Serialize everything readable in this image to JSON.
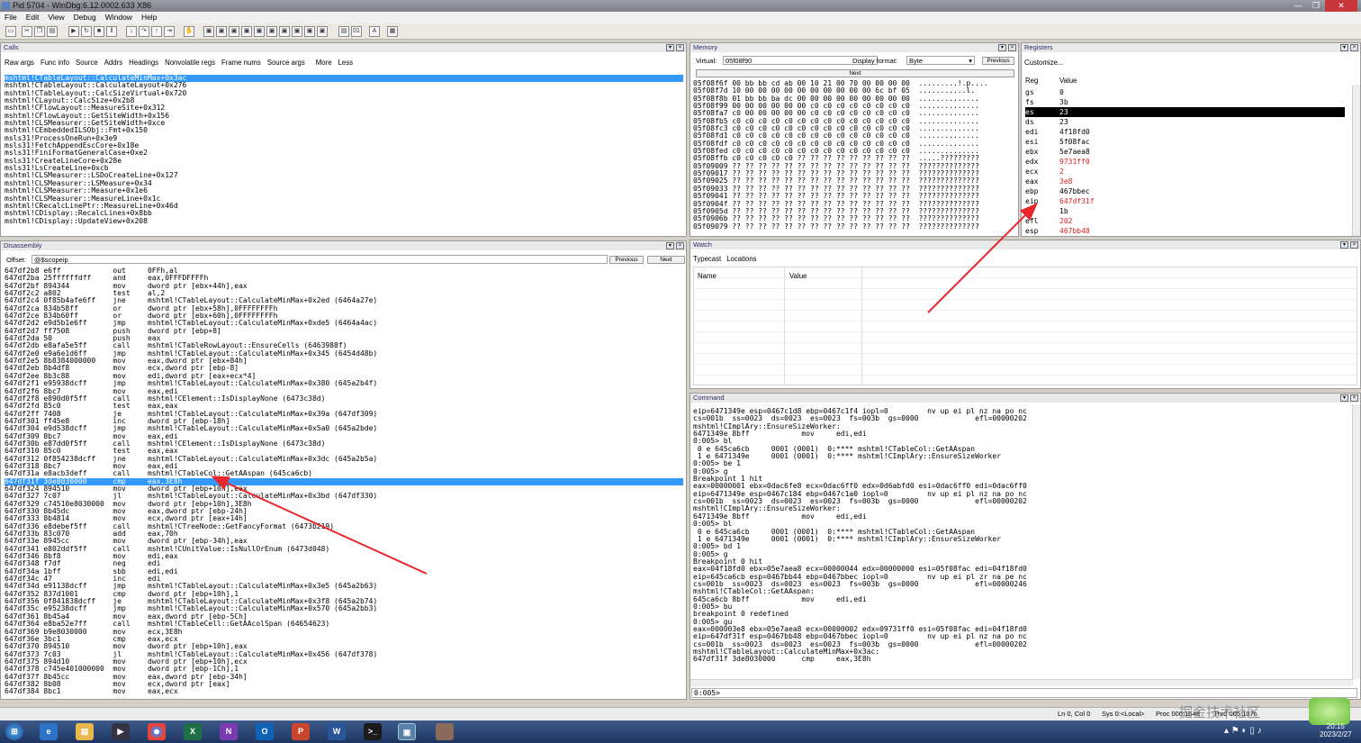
{
  "window": {
    "title": "Pid 5704 - WinDbg:6.12.0002.633 X86",
    "buttons": [
      "—",
      "❐",
      "✕"
    ]
  },
  "menu": [
    "File",
    "Edit",
    "View",
    "Debug",
    "Window",
    "Help"
  ],
  "calls": {
    "title": "Calls",
    "buttons": [
      "Raw args",
      "Func info",
      "Source",
      "Addrs",
      "Headings",
      "Nonvolatile regs",
      "Frame nums",
      "Source args",
      "More",
      "Less"
    ],
    "lines": [
      "mshtml!CTableLayout::CalculateMinMax+0x3ac",
      "mshtml!CTableLayout::CalculateLayout+0x276",
      "mshtml!CTableLayout::CalcSizeVirtual+0x720",
      "mshtml!CLayout::CalcSize+0x2b8",
      "mshtml!CFlowLayout::MeasureSite+0x312",
      "mshtml!CFlowLayout::GetSiteWidth+0x156",
      "mshtml!CLSMeasurer::GetSiteWidth+0xce",
      "mshtml!CEmbeddedILSObj::Fmt+0x150",
      "msls31!ProcessOneRun+0x3e9",
      "msls31!FetchAppendEscCore+0x18e",
      "msls31!FiniFormatGeneralCase+0xe2",
      "msls31!CreateLineCore+0x28e",
      "msls31!LsCreateLine+0xcb",
      "mshtml!CLSMeasurer::LSDoCreateLine+0x127",
      "mshtml!CLSMeasurer::LSMeasure+0x34",
      "mshtml!CLSMeasurer::Measure+0x1e6",
      "mshtml!CLSMeasurer::MeasureLine+0x1c",
      "mshtml!CRecalcLinePtr::MeasureLine+0x46d",
      "mshtml!CDisplay::RecalcLines+0x8bb",
      "mshtml!CDisplay::UpdateView+0x208"
    ]
  },
  "memory": {
    "title": "Memory",
    "virtual_label": "Virtual:",
    "virtual_value": "05f08f90",
    "display_format_label": "Display format:",
    "display_format_value": "Byte",
    "previous_label": "Previous",
    "next_label": "Next",
    "lines": [
      "05f08f6f 00 bb bb cd ab 00 10 21 00 70 00 00 00 00  .........!.p....",
      "05f08f7d 10 00 00 00 00 00 00 00 00 00 00 6c bf 05  ...........l.",
      "05f08f8b 01 bb bb ba dc 00 00 00 00 00 00 00 00 00  ..............",
      "05f08f99 00 00 00 00 00 00 c0 c0 c0 c0 c0 c0 c0 c0  ..............",
      "05f08fa7 c0 00 00 00 00 00 c0 c0 c0 c0 c0 c0 c0 c0  ..............",
      "05f08fb5 c0 c0 c0 c0 c0 c0 c0 c0 c0 c0 c0 c0 c0 c0  ..............",
      "05f08fc3 c0 c0 c0 c0 c0 c0 c0 c0 c0 c0 c0 c0 c0 c0  ..............",
      "05f08fd1 c0 c0 c0 c0 c0 c0 c0 c0 c0 c0 c0 c0 c0 c0  ..............",
      "05f08fdf c0 c0 c0 c0 c0 c0 c0 c0 c0 c0 c0 c0 c0 c0  ..............",
      "05f08fed c0 c0 c0 c0 c0 c0 c0 c0 c0 c0 c0 c0 c0 c0  ..............",
      "05f08ffb c0 c0 c0 c0 c0 ?? ?? ?? ?? ?? ?? ?? ?? ??  .....?????????",
      "05f09009 ?? ?? ?? ?? ?? ?? ?? ?? ?? ?? ?? ?? ?? ??  ??????????????",
      "05f09017 ?? ?? ?? ?? ?? ?? ?? ?? ?? ?? ?? ?? ?? ??  ??????????????",
      "05f09025 ?? ?? ?? ?? ?? ?? ?? ?? ?? ?? ?? ?? ?? ??  ??????????????",
      "05f09033 ?? ?? ?? ?? ?? ?? ?? ?? ?? ?? ?? ?? ?? ??  ??????????????",
      "05f09041 ?? ?? ?? ?? ?? ?? ?? ?? ?? ?? ?? ?? ?? ??  ??????????????",
      "05f0904f ?? ?? ?? ?? ?? ?? ?? ?? ?? ?? ?? ?? ?? ??  ??????????????",
      "05f0905d ?? ?? ?? ?? ?? ?? ?? ?? ?? ?? ?? ?? ?? ??  ??????????????",
      "05f0906b ?? ?? ?? ?? ?? ?? ?? ?? ?? ?? ?? ?? ?? ??  ??????????????",
      "05f09079 ?? ?? ?? ?? ?? ?? ?? ?? ?? ?? ?? ?? ?? ??  ??????????????"
    ]
  },
  "registers": {
    "title": "Registers",
    "customize_label": "Customize...",
    "col_reg": "Reg",
    "col_value": "Value",
    "rows": [
      {
        "reg": "gs",
        "value": "0",
        "changed": false,
        "selected": false
      },
      {
        "reg": "fs",
        "value": "3b",
        "changed": false,
        "selected": false
      },
      {
        "reg": "es",
        "value": "23",
        "changed": false,
        "selected": true
      },
      {
        "reg": "ds",
        "value": "23",
        "changed": false,
        "selected": false
      },
      {
        "reg": "edi",
        "value": "4f18fd0",
        "changed": false,
        "selected": false
      },
      {
        "reg": "esi",
        "value": "5f08fac",
        "changed": false,
        "selected": false
      },
      {
        "reg": "ebx",
        "value": "5e7aea8",
        "changed": false,
        "selected": false
      },
      {
        "reg": "edx",
        "value": "9731ff0",
        "changed": true,
        "selected": false
      },
      {
        "reg": "ecx",
        "value": "2",
        "changed": true,
        "selected": false
      },
      {
        "reg": "eax",
        "value": "3e8",
        "changed": true,
        "selected": false
      },
      {
        "reg": "ebp",
        "value": "467bbec",
        "changed": false,
        "selected": false
      },
      {
        "reg": "eip",
        "value": "647df31f",
        "changed": true,
        "selected": false
      },
      {
        "reg": "cs",
        "value": "1b",
        "changed": false,
        "selected": false
      },
      {
        "reg": "efl",
        "value": "202",
        "changed": true,
        "selected": false
      },
      {
        "reg": "esp",
        "value": "467bb48",
        "changed": true,
        "selected": false
      }
    ]
  },
  "watch": {
    "title": "Watch",
    "tabs": [
      "Typecast",
      "Locations"
    ],
    "col_name": "Name",
    "col_value": "Value"
  },
  "disassembly": {
    "title": "Disassembly",
    "offset_label": "Offset:",
    "offset_value": "@$scopeip",
    "previous_label": "Previous",
    "next_label": "Next",
    "highlight_index": 28,
    "lines": [
      "647df2b8 e6ff            out     0FFh,al",
      "647df2ba 25ffffffdff     and     eax,0FFFDFFFFh",
      "647df2bf 894344          mov     dword ptr [ebx+44h],eax",
      "647df2c2 a802            test    al,2",
      "647df2c4 0f85b4afe6ff    jne     mshtml!CTableLayout::CalculateMinMax+0x2ed (6464a27e)",
      "647df2ca 834b58ff        or      dword ptr [ebx+58h],0FFFFFFFFh",
      "647df2ce 834b60ff        or      dword ptr [ebx+60h],0FFFFFFFFh",
      "647df2d2 e9d5b1e6ff      jmp     mshtml!CTableLayout::CalculateMinMax+0xde5 (6464a4ac)",
      "647df2d7 ff7508          push    dword ptr [ebp+8]",
      "647df2da 50              push    eax",
      "647df2db e8afa5e5ff      call    mshtml!CTableRowLayout::EnsureCells (6463988f)",
      "647df2e0 e9a6e1d6ff      jmp     mshtml!CTableLayout::CalculateMinMax+0x345 (6454d48b)",
      "647df2e5 8b8384000000    mov     eax,dword ptr [ebx+84h]",
      "647df2eb 8b4df8          mov     ecx,dword ptr [ebp-8]",
      "647df2ee 8b3c88          mov     edi,dword ptr [eax+ecx*4]",
      "647df2f1 e95938dcff      jmp     mshtml!CTableLayout::CalculateMinMax+0x380 (645a2b4f)",
      "647df2f6 8bc7            mov     eax,edi",
      "647df2f8 e890d0f5ff      call    mshtml!CElement::IsDisplayNone (6473c38d)",
      "647df2fd 85c0            test    eax,eax",
      "647df2ff 7408            je      mshtml!CTableLayout::CalculateMinMax+0x39a (647df309)",
      "647df301 ff45e8          inc     dword ptr [ebp-18h]",
      "647df304 e9d538dcff      jmp     mshtml!CTableLayout::CalculateMinMax+0x5a0 (645a2bde)",
      "647df309 8bc7            mov     eax,edi",
      "647df30b e87dd0f5ff      call    mshtml!CElement::IsDisplayNone (6473c38d)",
      "647df310 85c0            test    eax,eax",
      "647df312 0f854238dcff    jne     mshtml!CTableLayout::CalculateMinMax+0x3dc (645a2b5a)",
      "647df318 8bc7            mov     eax,edi",
      "647df31a e8acb3deff      call    mshtml!CTableCol::GetAAspan (645ca6cb)",
      "647df31f 3de8030000      cmp     eax,3E8h",
      "647df324 894510          mov     dword ptr [ebp+10h],eax",
      "647df327 7c07            jl      mshtml!CTableLayout::CalculateMinMax+0x3bd (647df330)",
      "647df329 c74510e8030000  mov     dword ptr [ebp+10h],3E8h",
      "647df330 8b45dc          mov     eax,dword ptr [ebp-24h]",
      "647df333 8b4814          mov     ecx,dword ptr [eax+14h]",
      "647df336 e8debef5ff      call    mshtml!CTreeNode::GetFancyFormat (6473b219)",
      "647df33b 83c070          add     eax,70h",
      "647df33e 8945cc          mov     dword ptr [ebp-34h],eax",
      "647df341 e802ddf5ff      call    mshtml!CUnitValue::IsNullOrEnum (6473d048)",
      "647df346 8bf8            mov     edi,eax",
      "647df348 f7df            neg     edi",
      "647df34a 1bff            sbb     edi,edi",
      "647df34c 47              inc     edi",
      "647df34d e91138dcff      jmp     mshtml!CTableLayout::CalculateMinMax+0x3e5 (645a2b63)",
      "647df352 837d1001        cmp     dword ptr [ebp+10h],1",
      "647df356 0f841838dcff    je      mshtml!CTableLayout::CalculateMinMax+0x3f8 (645a2b74)",
      "647df35c e95238dcff      jmp     mshtml!CTableLayout::CalculateMinMax+0x570 (645a2bb3)",
      "647df361 8b45a4          mov     eax,dword ptr [ebp-5Ch]",
      "647df364 e8ba52e7ff      call    mshtml!CTableCell::GetAAcolSpan (64654623)",
      "647df369 b9e8030000      mov     ecx,3E8h",
      "647df36e 3bc1            cmp     eax,ecx",
      "647df370 894510          mov     dword ptr [ebp+10h],eax",
      "647df373 7c03            jl      mshtml!CTableLayout::CalculateMinMax+0x456 (647df378)",
      "647df375 894d10          mov     dword ptr [ebp+10h],ecx",
      "647df378 c745e401000000  mov     dword ptr [ebp-1Ch],1",
      "647df37f 8b45cc          mov     eax,dword ptr [ebp-34h]",
      "647df382 8b08            mov     ecx,dword ptr [eax]",
      "647df384 8bc1            mov     eax,ecx"
    ]
  },
  "command": {
    "title": "Command",
    "prompt": "0:005>",
    "lines": [
      "eip=6471349e esp=0467c1d8 ebp=0467c1f4 iopl=0         nv up ei pl nz na po nc",
      "cs=001b  ss=0023  ds=0023  es=0023  fs=003b  gs=0000             efl=00000202",
      "mshtml!CImplAry::EnsureSizeWorker:",
      "6471349e 8bff            mov     edi,edi",
      "0:005> bl",
      " 0 e 645ca6cb     0001 (0001)  0:**** mshtml!CTableCol::GetAAspan",
      " 1 e 6471349e     0001 (0001)  0:**** mshtml!CImplAry::EnsureSizeWorker",
      "0:005> be 1",
      "0:005> g",
      "Breakpoint 1 hit",
      "eax=00000001 ebx=0dac6fe8 ecx=0dac6ff0 edx=0d6abfd0 esi=0dac6ff0 edi=0dac6ff0",
      "eip=6471349e esp=0467c184 ebp=0467c1a0 iopl=0         nv up ei pl nz na po nc",
      "cs=001b  ss=0023  ds=0023  es=0023  fs=003b  gs=0000             efl=00000202",
      "mshtml!CImplAry::EnsureSizeWorker:",
      "6471349e 8bff            mov     edi,edi",
      "0:005> bl",
      " 0 e 645ca6cb     0001 (0001)  0:**** mshtml!CTableCol::GetAAspan",
      " 1 e 6471349e     0001 (0001)  0:**** mshtml!CImplAry::EnsureSizeWorker",
      "0:005> bd 1",
      "0:005> g",
      "Breakpoint 0 hit",
      "eax=04f18fd0 ebx=05e7aea8 ecx=00000044 edx=00000000 esi=05f08fac edi=04f18fd0",
      "eip=645ca6cb esp=0467bb44 ebp=0467bbec iopl=0         nv up ei pl zr na pe nc",
      "cs=001b  ss=0023  ds=0023  es=0023  fs=003b  gs=0000             efl=00000246",
      "mshtml!CTableCol::GetAAspan:",
      "645ca6cb 8bff            mov     edi,edi",
      "0:005> bu",
      "breakpoint 0 redefined",
      "0:005> gu",
      "eax=000003e8 ebx=05e7aea8 ecx=00000002 edx=09731ff0 esi=05f08fac edi=04f18fd0",
      "eip=647df31f esp=0467bb48 ebp=0467bbec iopl=0         nv up ei pl nz na po nc",
      "cs=001b  ss=0023  ds=0023  es=0023  fs=003b  gs=0000             efl=00000202",
      "mshtml!CTableLayout::CalculateMinMax+0x3ac:",
      "647df31f 3de8030000      cmp     eax,3E8h"
    ]
  },
  "statusbar": {
    "items": [
      "Ln 0, Col 0",
      "Sys 0:<Local>",
      "Proc 000:1648",
      "Thrd 005:107c"
    ]
  },
  "taskbar": {
    "clock_time": "20:15",
    "clock_date": "2023/2/27",
    "watermark": "掘金技术社区"
  }
}
